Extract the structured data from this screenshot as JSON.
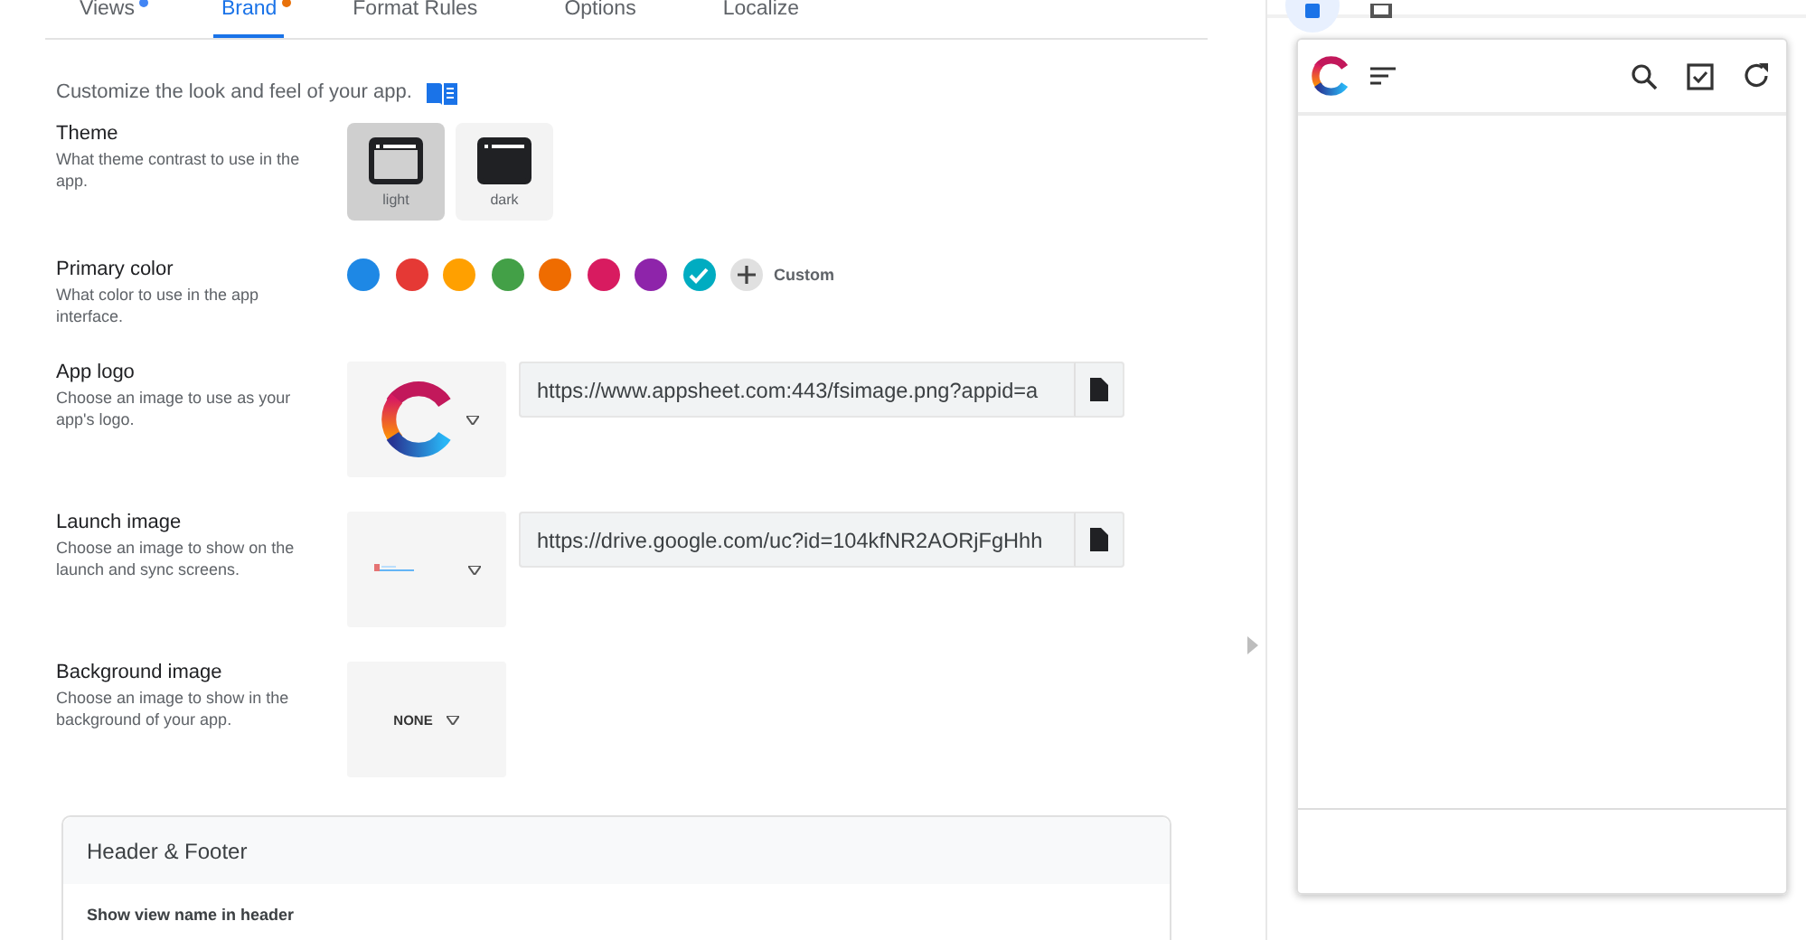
{
  "tabs": [
    {
      "label": "Views",
      "selected": false,
      "color": "#4285f4"
    },
    {
      "label": "Brand",
      "selected": true,
      "color": "#e8710a"
    },
    {
      "label": "Format Rules",
      "selected": false
    },
    {
      "label": "Options",
      "selected": false
    },
    {
      "label": "Localize",
      "selected": false
    }
  ],
  "intro": "Customize the look and feel of your app.",
  "settings": [
    {
      "kind": "theme",
      "title": "Theme",
      "description": "What theme contrast to use in the app.",
      "options": [
        {
          "label": "light",
          "kind": "light",
          "selected": true
        },
        {
          "label": "dark",
          "kind": "dark",
          "selected": false
        }
      ]
    },
    {
      "kind": "colors",
      "title": "Primary color",
      "description": "What color to use in the app interface.",
      "colors": [
        {
          "color": "#1e88e5",
          "selected": false
        },
        {
          "color": "#e53935",
          "selected": false
        },
        {
          "color": "#ffa000",
          "selected": false
        },
        {
          "color": "#43a047",
          "selected": false
        },
        {
          "color": "#ef6c00",
          "selected": false
        },
        {
          "color": "#d81b60",
          "selected": false
        },
        {
          "color": "#8e24aa",
          "selected": false
        },
        {
          "color": "#00acc1",
          "selected": true
        }
      ],
      "custom_label": "Custom"
    },
    {
      "title": "App logo",
      "description": "Choose an image to use as your app's logo.",
      "preview": {
        "kind": "logo"
      },
      "url": "https://www.appsheet.com:443/fsimage.png?appid=a"
    },
    {
      "title": "Launch image",
      "description": "Choose an image to show on the launch and sync screens.",
      "preview": {
        "kind": "launch"
      },
      "url": "https://drive.google.com/uc?id=104kfNR2AORjFgHhh"
    },
    {
      "title": "Background image",
      "description": "Choose an image to show in the background of your app.",
      "preview": {
        "kind": "none"
      },
      "choice": "NONE"
    }
  ],
  "header_footer": {
    "title": "Header & Footer",
    "first_option": "Show view name in header"
  },
  "preview": {
    "device_buttons": [
      {
        "kind": "phone",
        "selected": true
      },
      {
        "kind": "tablet",
        "selected": false
      }
    ]
  }
}
